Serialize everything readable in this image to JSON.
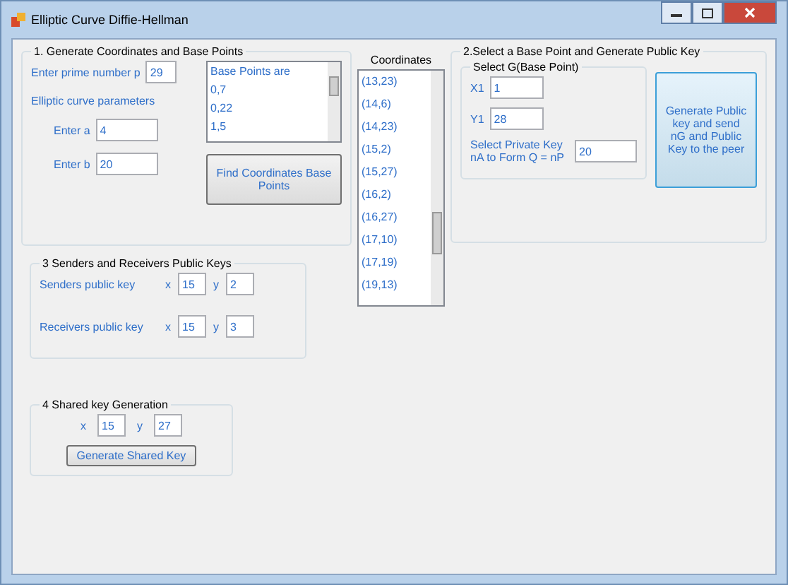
{
  "window": {
    "title": "Elliptic Curve Diffie-Hellman"
  },
  "section_1": {
    "title": "1. Generate Coordinates and Base Points",
    "prime_label": "Enter prime number p",
    "prime_value": "29",
    "params_label": "Elliptic curve parameters",
    "a_label": "Enter a",
    "a_value": "4",
    "b_label": "Enter b",
    "b_value": "20",
    "base_points": [
      "Base Points are",
      "0,7",
      "0,22",
      "1,5"
    ],
    "button": "Find Coordinates Base Points"
  },
  "coordinates": {
    "title": "Coordinates",
    "items": [
      "(13,23)",
      "(14,6)",
      "(14,23)",
      "(15,2)",
      "(15,27)",
      "(16,2)",
      "(16,27)",
      "(17,10)",
      "(17,19)",
      "(19,13)"
    ]
  },
  "section_2": {
    "title": "2.Select a Base Point and Generate Public Key",
    "group_title": "Select G(Base Point)",
    "x_label": "X1",
    "x_value": "1",
    "y_label": "Y1",
    "y_value": "28",
    "key_label": "Select Private Key nA to Form Q = nP",
    "key_value": "20",
    "button": "Generate Public key and send nG and Public Key to the peer"
  },
  "section_3": {
    "title": "3 Senders and Receivers Public Keys",
    "rows": [
      {
        "label": "Senders public key",
        "x_label": "x",
        "x_value": "15",
        "y_label": "y",
        "y_value": "2"
      },
      {
        "label": "Receivers public key",
        "x_label": "x",
        "x_value": "15",
        "y_label": "y",
        "y_value": "3"
      }
    ]
  },
  "section_4": {
    "title": "4 Shared key Generation",
    "x_label": "x",
    "x_value": "15",
    "y_label": "y",
    "y_value": "27",
    "button": "Generate Shared Key"
  }
}
